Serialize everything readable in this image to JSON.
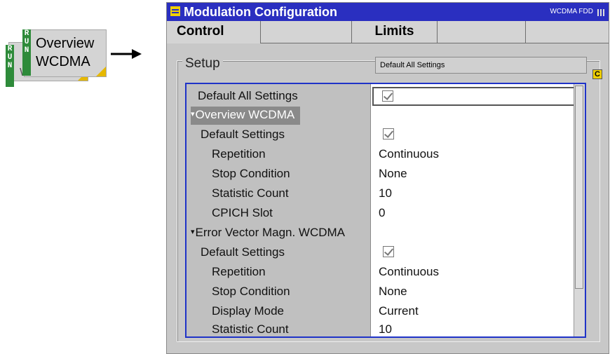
{
  "softkey": {
    "back_label_line1": "Overview",
    "back_label_line2": "WCDMA",
    "front_label_line1": "Overview",
    "front_label_line2": "WCDMA",
    "run_badge": "RUN"
  },
  "window": {
    "title": "Modulation Configuration",
    "mode": "WCDMA FDD",
    "tabs": [
      {
        "label": "Control",
        "active": true
      },
      {
        "label": "",
        "active": false
      },
      {
        "label": "Limits",
        "active": false
      },
      {
        "label": "",
        "active": false
      },
      {
        "label": "",
        "active": false
      }
    ],
    "setup_title": "Setup",
    "hint": "Default All Settings",
    "c_button": "C"
  },
  "settings": {
    "default_all": {
      "label": "Default All Settings",
      "checked": true
    },
    "overview_group": "Overview WCDMA",
    "overview": [
      {
        "label": "Default Settings",
        "value": "",
        "checkbox": true
      },
      {
        "label": "Repetition",
        "value": "Continuous"
      },
      {
        "label": "Stop Condition",
        "value": "None"
      },
      {
        "label": "Statistic Count",
        "value": "10"
      },
      {
        "label": "CPICH Slot",
        "value": "0"
      }
    ],
    "evm_group": "Error Vector Magn. WCDMA",
    "evm": [
      {
        "label": "Default Settings",
        "value": "",
        "checkbox": true
      },
      {
        "label": "Repetition",
        "value": "Continuous"
      },
      {
        "label": "Stop Condition",
        "value": "None"
      },
      {
        "label": "Display Mode",
        "value": "Current"
      },
      {
        "label": "Statistic Count",
        "value": "10"
      }
    ]
  },
  "colors": {
    "title_bar": "#2a2fc0",
    "focus_border": "#1f33c8",
    "run_badge": "#2e8b3a",
    "corner_accent": "#e6b800"
  }
}
